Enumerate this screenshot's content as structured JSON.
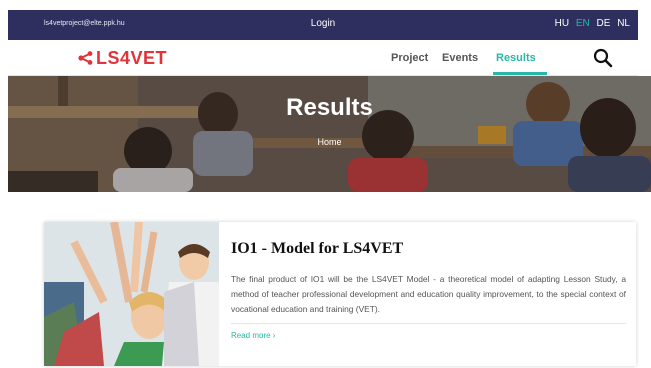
{
  "topbar": {
    "email": "ls4vetproject@elte.ppk.hu",
    "login": "Login",
    "languages": [
      {
        "code": "HU",
        "active": false
      },
      {
        "code": "EN",
        "active": true
      },
      {
        "code": "DE",
        "active": false
      },
      {
        "code": "NL",
        "active": false
      }
    ]
  },
  "navbar": {
    "logo": "LS4VET",
    "items": [
      {
        "label": "Project",
        "active": false
      },
      {
        "label": "Events",
        "active": false
      },
      {
        "label": "Results",
        "active": true
      }
    ],
    "search_icon": "search-icon"
  },
  "hero": {
    "title": "Results",
    "breadcrumb": "Home"
  },
  "card": {
    "title": "IO1 - Model for LS4VET",
    "text": "The final product of IO1 will be the LS4VET Model - a theoretical model of adapting Lesson Study, a method of teacher professional development and education quality improvement, to the special context of vocational education and training (VET).",
    "read_more": "Read more ›"
  },
  "colors": {
    "topbar": "#2e2f5e",
    "accent": "#29b7a8",
    "logo": "#e0343a"
  }
}
